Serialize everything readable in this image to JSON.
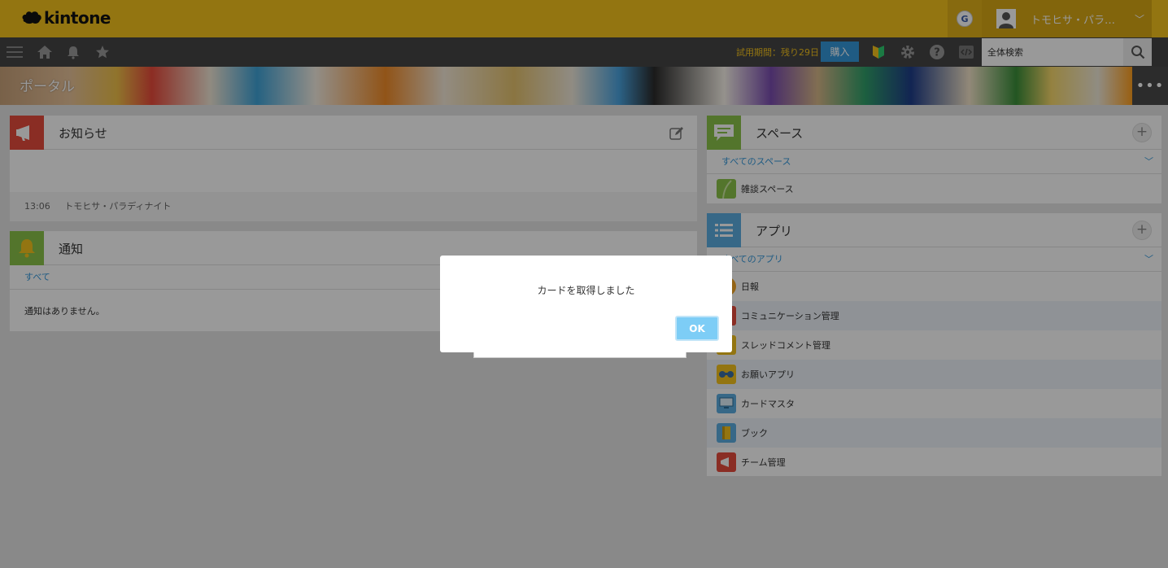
{
  "header": {
    "brand": "kintone",
    "g_label": "G",
    "user_name": "トモヒサ・パラ…",
    "user_chevron": "﹀"
  },
  "navbar": {
    "trial_text": "試用期間：残り29日",
    "buy_label": "購入",
    "search_placeholder": "全体検索"
  },
  "banner": {
    "title": "ポータル",
    "more_label": "•••"
  },
  "notice_widget": {
    "title": "お知らせ",
    "time": "13:06",
    "author": "トモヒサ・パラディナイト"
  },
  "notification_widget": {
    "title": "通知",
    "filter_label": "すべて",
    "empty_text": "通知はありません。"
  },
  "space_widget": {
    "title": "スペース",
    "all_label": "すべてのスペース",
    "items": [
      {
        "label": "雑談スペース"
      }
    ]
  },
  "app_widget": {
    "title": "アプリ",
    "all_label": "すべてのアプリ",
    "items": [
      {
        "label": "日報",
        "color": "#f5a623"
      },
      {
        "label": "コミュニケーション管理",
        "color": "#e74c3c"
      },
      {
        "label": "スレッドコメント管理",
        "color": "#f5c31d"
      },
      {
        "label": "お願いアプリ",
        "color": "#f5c31d"
      },
      {
        "label": "カードマスタ",
        "color": "#5dade2"
      },
      {
        "label": "ブック",
        "color": "#5dade2"
      },
      {
        "label": "チーム管理",
        "color": "#e74c3c"
      }
    ]
  },
  "dialog": {
    "message": "カードを取得しました",
    "ok_label": "OK"
  },
  "colors": {
    "header_yellow": "#f5c31d",
    "navbar_dark": "#454545",
    "accent_blue": "#3498db"
  }
}
